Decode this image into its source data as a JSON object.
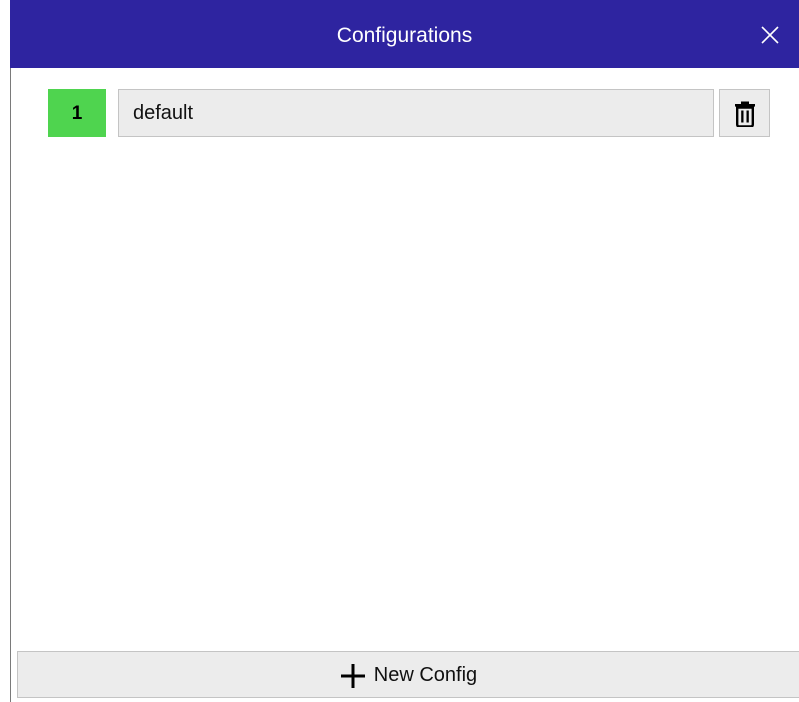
{
  "window": {
    "title": "Configurations",
    "title_bar_color": "#2e24a0"
  },
  "configs": [
    {
      "index": "1",
      "name": "default",
      "badge_color": "#4fd44f"
    }
  ],
  "footer": {
    "new_config_label": "New Config"
  },
  "icons": {
    "close": "close-icon",
    "delete": "trash-icon",
    "add": "plus-icon"
  }
}
